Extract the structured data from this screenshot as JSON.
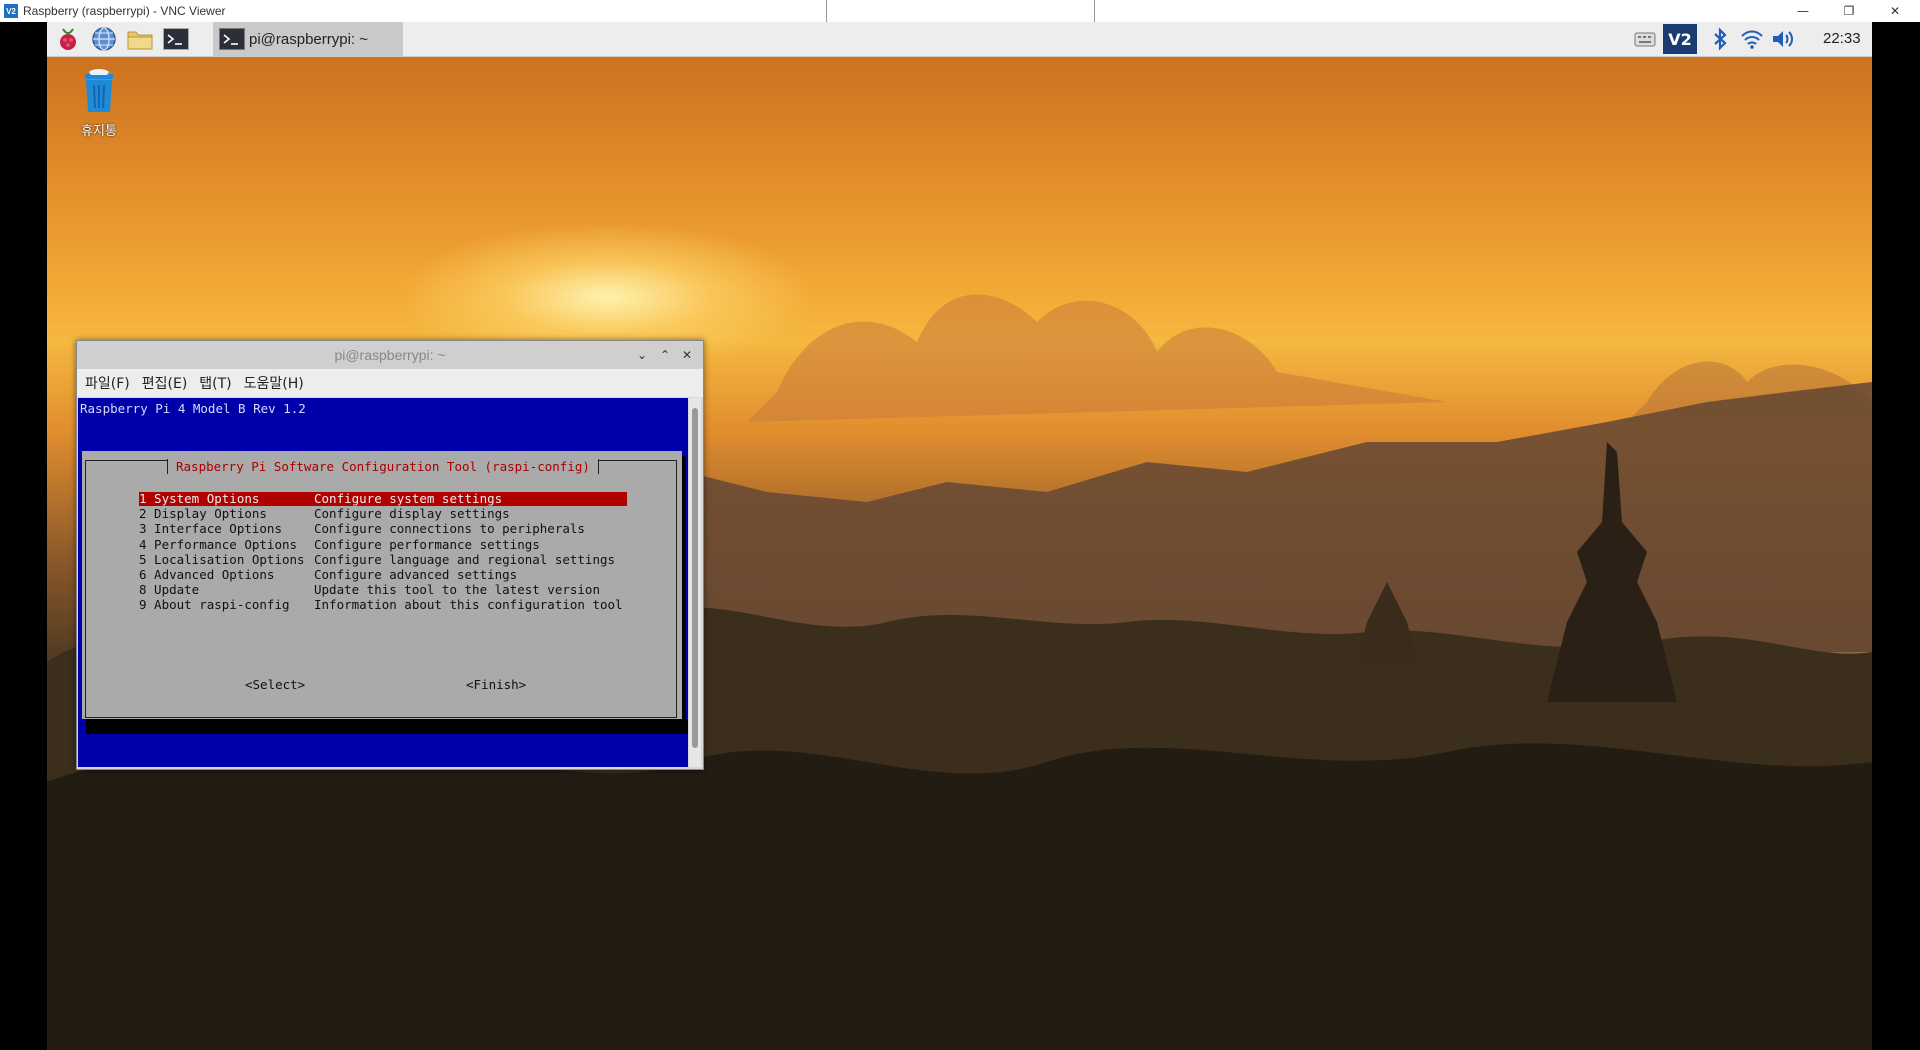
{
  "host": {
    "title": "Raspberry (raspberrypi) - VNC Viewer",
    "app_icon_text": "V2",
    "controls": {
      "minimize": "—",
      "restore": "❐",
      "close": "✕"
    }
  },
  "panel": {
    "task_label": "pi@raspberrypi: ~",
    "clock": "22:33",
    "vnc_badge": "V2"
  },
  "desktop": {
    "trash_label": "휴지통"
  },
  "terminal": {
    "title": "pi@raspberrypi: ~",
    "titlebar_buttons": {
      "minimize": "⌄",
      "maximize": "⌃",
      "close": "✕"
    },
    "menu": [
      "파일(F)",
      "편집(E)",
      "탭(T)",
      "도움말(H)"
    ],
    "model_line": "Raspberry Pi 4 Model B Rev 1.2",
    "dialog_title": "Raspberry Pi Software Configuration Tool (raspi-config)",
    "menu_items": [
      {
        "option": "1 System Options",
        "desc": "Configure system settings",
        "selected": true
      },
      {
        "option": "2 Display Options",
        "desc": "Configure display settings",
        "selected": false
      },
      {
        "option": "3 Interface Options",
        "desc": "Configure connections to peripherals",
        "selected": false
      },
      {
        "option": "4 Performance Options",
        "desc": "Configure performance settings",
        "selected": false
      },
      {
        "option": "5 Localisation Options",
        "desc": "Configure language and regional settings",
        "selected": false
      },
      {
        "option": "6 Advanced Options",
        "desc": "Configure advanced settings",
        "selected": false
      },
      {
        "option": "8 Update",
        "desc": "Update this tool to the latest version",
        "selected": false
      },
      {
        "option": "9 About raspi-config",
        "desc": "Information about this configuration tool",
        "selected": false
      }
    ],
    "select_label": "<Select>",
    "finish_label": "<Finish>"
  },
  "colors": {
    "terminal_bg": "#0000aa",
    "dialog_bg": "#aaaaaa",
    "selection": "#b00000",
    "title_red": "#aa0000"
  }
}
